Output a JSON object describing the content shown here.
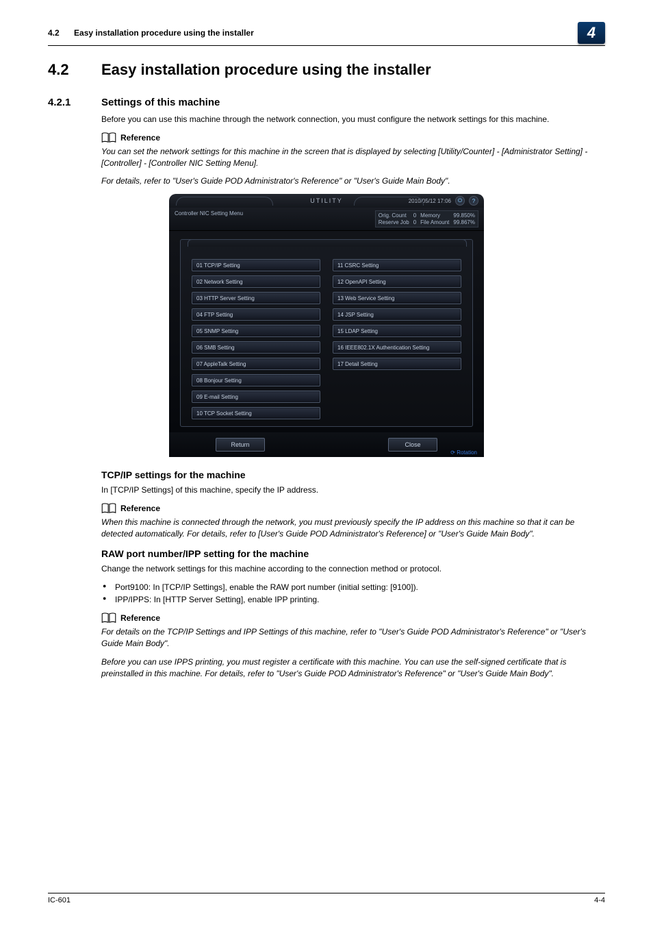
{
  "header": {
    "section_number": "4.2",
    "section_title": "Easy installation procedure using the installer",
    "chapter_badge": "4"
  },
  "h1": {
    "number": "4.2",
    "title": "Easy installation procedure using the installer"
  },
  "s1": {
    "number": "4.2.1",
    "title": "Settings of this machine",
    "intro": "Before you can use this machine through the network connection, you must configure the network settings for this machine.",
    "ref_label": "Reference",
    "ref_p1": "You can set the network settings for this machine in the screen that is displayed by selecting [Utility/Counter] - [Administrator Setting] - [Controller] - [Controller NIC Setting Menu].",
    "ref_p2": "For details, refer to \"User's Guide POD Administrator's Reference\" or \"User's Guide Main Body\"."
  },
  "ui": {
    "title": "UTILITY",
    "datetime": "2010/05/12 17:06",
    "menu_label": "Controller NIC Setting Menu",
    "status": {
      "k1": "Orig. Count",
      "v1": "0",
      "k2": "Memory",
      "v2": "99.850%",
      "k3": "Reserve Job",
      "v3": "0",
      "k4": "File Amount",
      "v4": "99.867%"
    },
    "left_buttons": [
      "01 TCP/IP Setting",
      "02 Network Setting",
      "03 HTTP Server Setting",
      "04 FTP Setting",
      "05 SNMP Setting",
      "06 SMB Setting",
      "07 AppleTalk Setting",
      "08 Bonjour Setting",
      "09 E-mail Setting",
      "10 TCP Socket Setting"
    ],
    "right_buttons": [
      "11 CSRC Setting",
      "12 OpenAPI Setting",
      "13 Web Service Setting",
      "14 JSP Setting",
      "15 LDAP Setting",
      "16 IEEE802.1X Authentication Setting",
      "17 Detail Setting"
    ],
    "return": "Return",
    "close": "Close",
    "rotation": "⟳ Rotation"
  },
  "s2": {
    "title": "TCP/IP settings for the machine",
    "p1": "In [TCP/IP Settings] of this machine, specify the IP address.",
    "ref_label": "Reference",
    "ref_p1": "When this machine is connected through the network, you must previously specify the IP address on this machine so that it can be detected automatically. For details, refer to [User's Guide POD Administrator's Reference] or \"User's Guide Main Body\"."
  },
  "s3": {
    "title": "RAW port number/IPP setting for the machine",
    "p1": "Change the network settings for this machine according to the connection method or protocol.",
    "b1": "Port9100: In [TCP/IP Settings], enable the RAW port number (initial setting: [9100]).",
    "b2": "IPP/IPPS: In [HTTP Server Setting], enable IPP printing.",
    "ref_label": "Reference",
    "ref_p1": "For details on the TCP/IP Settings and IPP Settings of this machine, refer to \"User's Guide POD Administrator's Reference\" or \"User's Guide Main Body\".",
    "ref_p2": "Before you can use IPPS printing, you must register a certificate with this machine. You can use the self-signed certificate that is preinstalled in this machine. For details, refer to \"User's Guide POD Administrator's Reference\" or \"User's Guide Main Body\"."
  },
  "footer": {
    "product": "IC-601",
    "page": "4-4"
  }
}
